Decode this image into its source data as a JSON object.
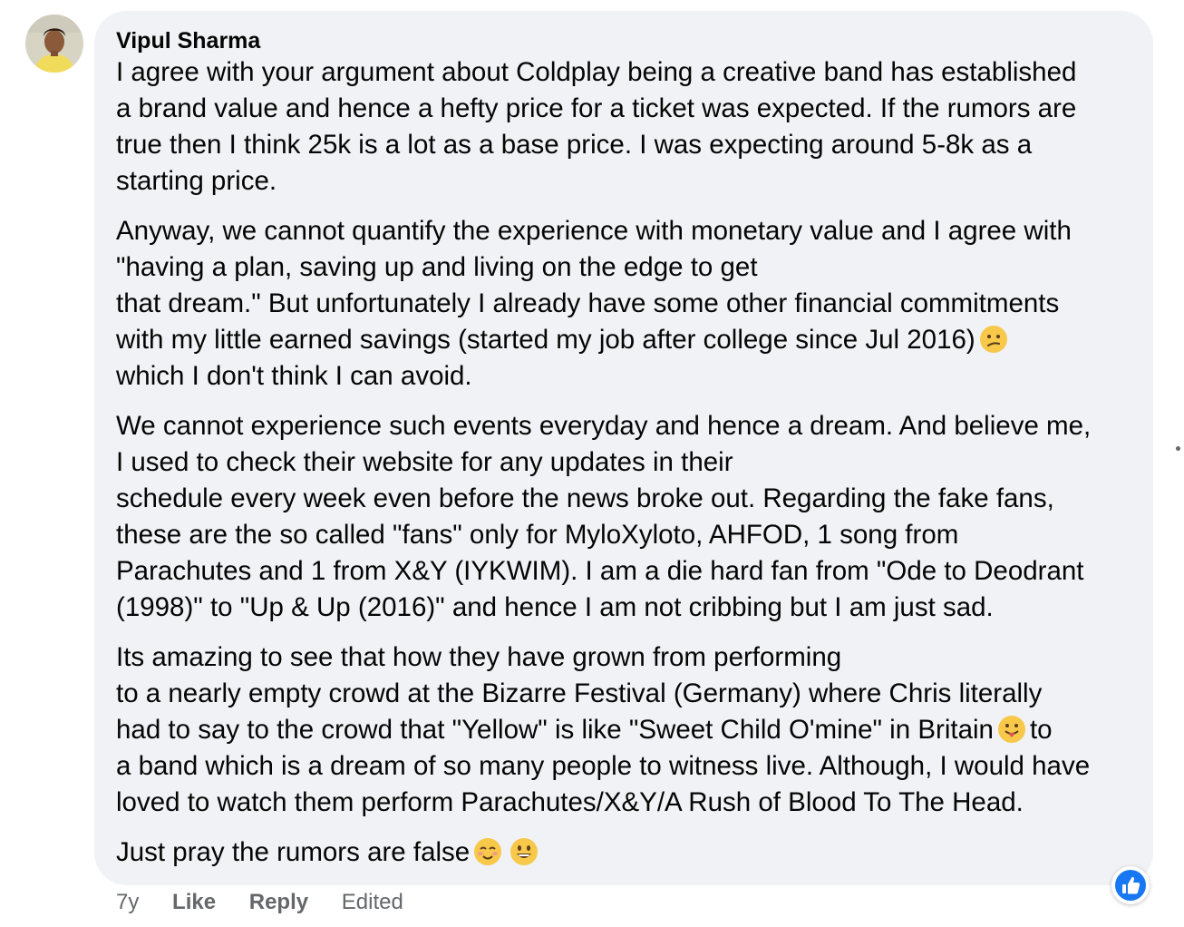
{
  "comment": {
    "author": "Vipul Sharma",
    "paragraphs": [
      [
        "I agree with your argument about Coldplay being a creative band has established",
        "a brand value and hence a hefty price for a ticket was expected. If the rumors are",
        "true then I think 25k is a lot as a base price. I was expecting around 5-8k as a",
        "starting price."
      ],
      [
        "Anyway, we cannot quantify the experience with monetary value and I agree with",
        "\"having a plan, saving up and living on the edge to get",
        "that dream.\" But unfortunately I already have some other financial commitments",
        "with my little earned savings (started my job after college since Jul 2016)",
        "which I don't think I can avoid."
      ],
      [
        "We cannot experience such events everyday and hence a dream. And believe me,",
        "I used to check their website for any updates in their",
        "schedule every week even before the news broke out. Regarding the fake fans,",
        "these are the so called \"fans\" only for MyloXyloto, AHFOD, 1 song from",
        "Parachutes and 1 from X&Y (IYKWIM). I am a die hard fan from \"Ode to Deodrant",
        "(1998)\" to \"Up & Up (2016)\" and hence I am not cribbing but I am just sad."
      ],
      [
        "Its amazing to see that how they have grown from performing",
        "to a nearly empty crowd at the Bizarre Festival (Germany) where Chris literally",
        "had to say to the crowd that \"Yellow\" is like \"Sweet Child O'mine\" in Britain",
        "to",
        "a band which is a dream of so many people to witness live. Although, I would have",
        "loved to watch them perform Parachutes/X&Y/A Rush of Blood To The Head."
      ],
      [
        "Just pray the rumors are false"
      ]
    ],
    "emojis": {
      "confused": "confused-face-icon",
      "tongue": "face-with-tongue-icon",
      "smiling_hearts": "smiling-face-icon",
      "grin": "grinning-face-icon"
    }
  },
  "actions": {
    "time": "7y",
    "like": "Like",
    "reply": "Reply",
    "edited": "Edited"
  },
  "reaction": {
    "icon": "thumbs-up-icon",
    "color": "#1877f2"
  },
  "colors": {
    "bubble": "#f0f2f5",
    "meta_text": "#65676b",
    "text": "#050505"
  }
}
